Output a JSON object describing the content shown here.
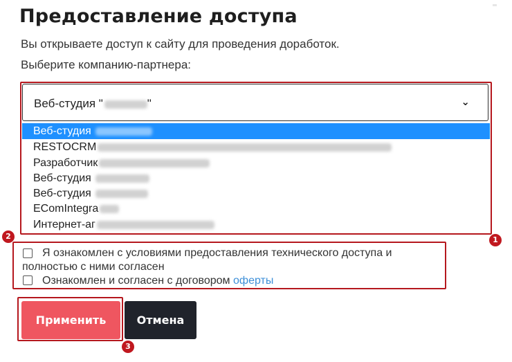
{
  "page": {
    "title": "Предоставление доступа",
    "subtitle": "Вы открываете доступ к сайту для проведения доработок.",
    "prompt": "Выберите компанию-партнера:"
  },
  "select": {
    "value": "Веб-студия \"",
    "value_suffix": "\"",
    "options": [
      {
        "label": "Веб-студия",
        "selected": true
      },
      {
        "label": "RESTOCRM",
        "selected": false
      },
      {
        "label": "Разработчик",
        "selected": false
      },
      {
        "label": "Веб-студия",
        "selected": false
      },
      {
        "label": "Веб-студия",
        "selected": false
      },
      {
        "label": "EComIntegra",
        "selected": false
      },
      {
        "label": "Интернет-аг",
        "selected": false
      }
    ]
  },
  "agreements": {
    "terms_line1": "Я ознакомлен с условиями предоставления технического доступа и",
    "terms_line2": "полностью с ними согласен",
    "contract_text": "Ознакомлен и согласен с договором ",
    "contract_link": "оферты"
  },
  "buttons": {
    "apply": "Применить",
    "cancel": "Отмена"
  },
  "badges": {
    "one": "1",
    "two": "2",
    "three": "3"
  },
  "colors": {
    "accent": "#ef5660",
    "highlight": "#1e90ff",
    "annotation": "#b5171d",
    "cancel_bg": "#20232b",
    "link": "#3d8fd8"
  },
  "icons": {
    "select_toggle": "chevron-down-icon"
  }
}
